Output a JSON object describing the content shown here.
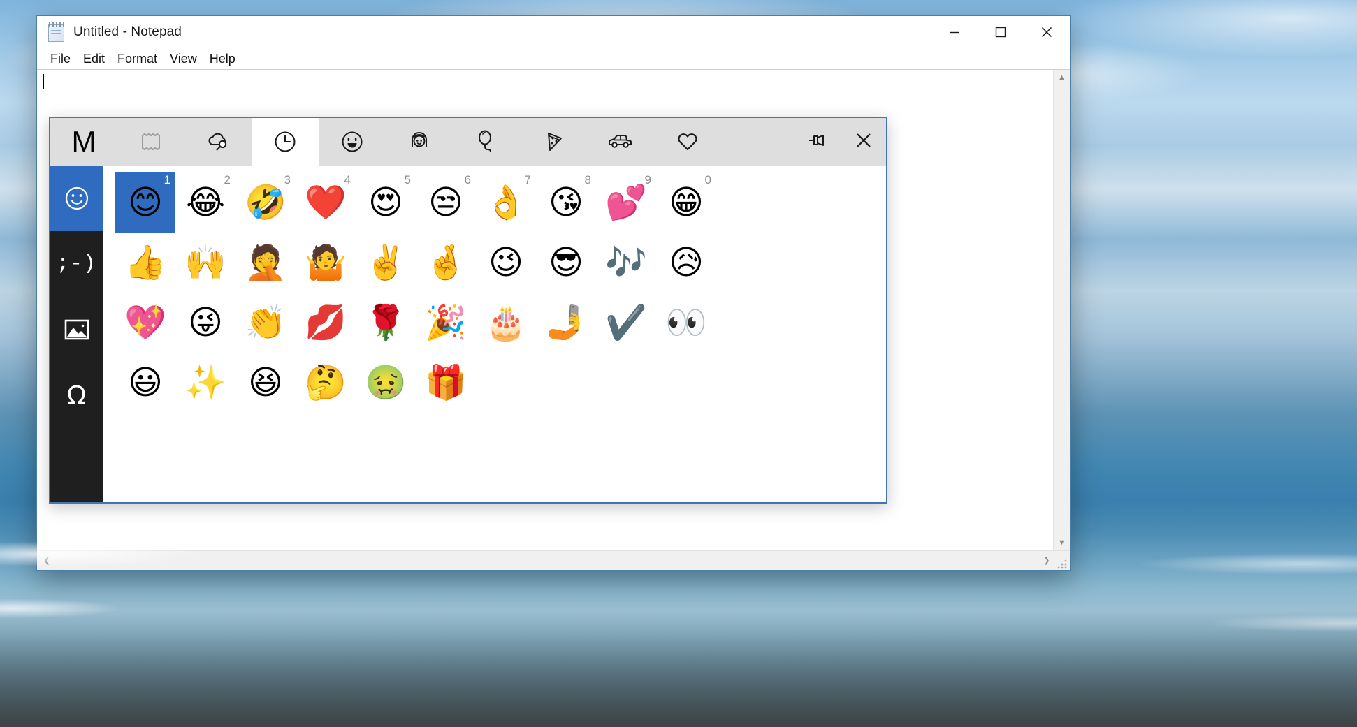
{
  "window": {
    "title": "Untitled - Notepad",
    "icon": "notepad-icon",
    "minimize_label": "Minimize",
    "maximize_label": "Maximize",
    "close_label": "Close"
  },
  "menubar": {
    "items": [
      {
        "label": "File"
      },
      {
        "label": "Edit"
      },
      {
        "label": "Format"
      },
      {
        "label": "View"
      },
      {
        "label": "Help"
      }
    ]
  },
  "editor": {
    "text": "",
    "caret_visible": true
  },
  "scrollbars": {
    "up_arrow": "▲",
    "down_arrow": "▼",
    "left_arrow": "❮",
    "right_arrow": "❯"
  },
  "emoji_panel": {
    "tabs": [
      {
        "name": "tab-gif-logo",
        "icon": "microsoft-m-logo",
        "glyph": "M",
        "active": false,
        "disabled": false
      },
      {
        "name": "tab-clipboard",
        "icon": "clipboard-history-icon",
        "glyph": "",
        "active": false,
        "disabled": true
      },
      {
        "name": "tab-gif-search",
        "icon": "cloud-search-icon",
        "glyph": "",
        "active": false,
        "disabled": false
      },
      {
        "name": "tab-recent",
        "icon": "clock-icon",
        "glyph": "",
        "active": true,
        "disabled": false
      },
      {
        "name": "tab-smileys",
        "icon": "smiley-face-icon",
        "glyph": "",
        "active": false,
        "disabled": false
      },
      {
        "name": "tab-people",
        "icon": "person-face-icon",
        "glyph": "",
        "active": false,
        "disabled": false
      },
      {
        "name": "tab-celebration",
        "icon": "balloon-icon",
        "glyph": "",
        "active": false,
        "disabled": false
      },
      {
        "name": "tab-food",
        "icon": "pizza-slice-icon",
        "glyph": "",
        "active": false,
        "disabled": false
      },
      {
        "name": "tab-transport",
        "icon": "car-icon",
        "glyph": "",
        "active": false,
        "disabled": false
      },
      {
        "name": "tab-symbols",
        "icon": "heart-outline-icon",
        "glyph": "",
        "active": false,
        "disabled": false
      }
    ],
    "buttons": [
      {
        "name": "pin-button",
        "icon": "pushpin-icon",
        "label": "Pin"
      },
      {
        "name": "close-button",
        "icon": "close-icon",
        "label": "Close"
      }
    ],
    "categories": [
      {
        "name": "category-emoji",
        "icon": "smiley-outline-icon",
        "glyph": "",
        "active": true
      },
      {
        "name": "category-kaomoji",
        "icon": "kaomoji-icon",
        "glyph": ";-)",
        "active": false
      },
      {
        "name": "category-gif",
        "icon": "picture-icon",
        "glyph": "",
        "active": false
      },
      {
        "name": "category-symbols",
        "icon": "omega-icon",
        "glyph": "Ω",
        "active": false
      }
    ],
    "grid": {
      "rows": [
        [
          {
            "name": "emoji-smiling-face",
            "glyph": "😊",
            "hotkey": "1",
            "selected": true
          },
          {
            "name": "emoji-joy",
            "glyph": "😂",
            "hotkey": "2",
            "selected": false
          },
          {
            "name": "emoji-rofl",
            "glyph": "🤣",
            "hotkey": "3",
            "selected": false
          },
          {
            "name": "emoji-red-heart",
            "glyph": "❤️",
            "hotkey": "4",
            "selected": false
          },
          {
            "name": "emoji-heart-eyes",
            "glyph": "😍",
            "hotkey": "5",
            "selected": false
          },
          {
            "name": "emoji-unamused",
            "glyph": "😒",
            "hotkey": "6",
            "selected": false
          },
          {
            "name": "emoji-ok-hand",
            "glyph": "👌",
            "hotkey": "7",
            "selected": false
          },
          {
            "name": "emoji-kissing-heart",
            "glyph": "😘",
            "hotkey": "8",
            "selected": false
          },
          {
            "name": "emoji-two-hearts",
            "glyph": "💕",
            "hotkey": "9",
            "selected": false
          },
          {
            "name": "emoji-grinning",
            "glyph": "😁",
            "hotkey": "0",
            "selected": false
          }
        ],
        [
          {
            "name": "emoji-thumbs-up",
            "glyph": "👍",
            "hotkey": "",
            "selected": false
          },
          {
            "name": "emoji-raising-hands",
            "glyph": "🙌",
            "hotkey": "",
            "selected": false
          },
          {
            "name": "emoji-facepalm",
            "glyph": "🤦",
            "hotkey": "",
            "selected": false
          },
          {
            "name": "emoji-shrug",
            "glyph": "🤷",
            "hotkey": "",
            "selected": false
          },
          {
            "name": "emoji-victory-hand",
            "glyph": "✌️",
            "hotkey": "",
            "selected": false
          },
          {
            "name": "emoji-crossed-fingers",
            "glyph": "🤞",
            "hotkey": "",
            "selected": false
          },
          {
            "name": "emoji-winking-face",
            "glyph": "😉",
            "hotkey": "",
            "selected": false
          },
          {
            "name": "emoji-sunglasses",
            "glyph": "😎",
            "hotkey": "",
            "selected": false
          },
          {
            "name": "emoji-musical-notes",
            "glyph": "🎶",
            "hotkey": "",
            "selected": false
          },
          {
            "name": "emoji-sad-relieved",
            "glyph": "😥",
            "hotkey": "",
            "selected": false
          }
        ],
        [
          {
            "name": "emoji-sparkling-heart",
            "glyph": "💖",
            "hotkey": "",
            "selected": false
          },
          {
            "name": "emoji-winking-tongue",
            "glyph": "😜",
            "hotkey": "",
            "selected": false
          },
          {
            "name": "emoji-clapping-hands",
            "glyph": "👏",
            "hotkey": "",
            "selected": false
          },
          {
            "name": "emoji-kiss-mark",
            "glyph": "💋",
            "hotkey": "",
            "selected": false
          },
          {
            "name": "emoji-rose",
            "glyph": "🌹",
            "hotkey": "",
            "selected": false
          },
          {
            "name": "emoji-party-popper",
            "glyph": "🎉",
            "hotkey": "",
            "selected": false
          },
          {
            "name": "emoji-birthday-cake",
            "glyph": "🎂",
            "hotkey": "",
            "selected": false
          },
          {
            "name": "emoji-selfie",
            "glyph": "🤳",
            "hotkey": "",
            "selected": false
          },
          {
            "name": "emoji-check-mark",
            "glyph": "✔️",
            "hotkey": "",
            "selected": false
          },
          {
            "name": "emoji-eyes",
            "glyph": "👀",
            "hotkey": "",
            "selected": false
          }
        ],
        [
          {
            "name": "emoji-grinning-face",
            "glyph": "😃",
            "hotkey": "",
            "selected": false
          },
          {
            "name": "emoji-sparkles",
            "glyph": "✨",
            "hotkey": "",
            "selected": false
          },
          {
            "name": "emoji-squinting-laugh",
            "glyph": "😆",
            "hotkey": "",
            "selected": false
          },
          {
            "name": "emoji-thinking-face",
            "glyph": "🤔",
            "hotkey": "",
            "selected": false
          },
          {
            "name": "emoji-nauseated-face",
            "glyph": "🤢",
            "hotkey": "",
            "selected": false
          },
          {
            "name": "emoji-wrapped-gift",
            "glyph": "🎁",
            "hotkey": "",
            "selected": false
          }
        ]
      ]
    }
  },
  "colors": {
    "accent": "#2f6cc0",
    "panel_border": "#3f77b5",
    "tabbar_bg": "#dedede",
    "category_bg": "#1f1f1f",
    "hotkey_text": "#8d8d8d"
  }
}
